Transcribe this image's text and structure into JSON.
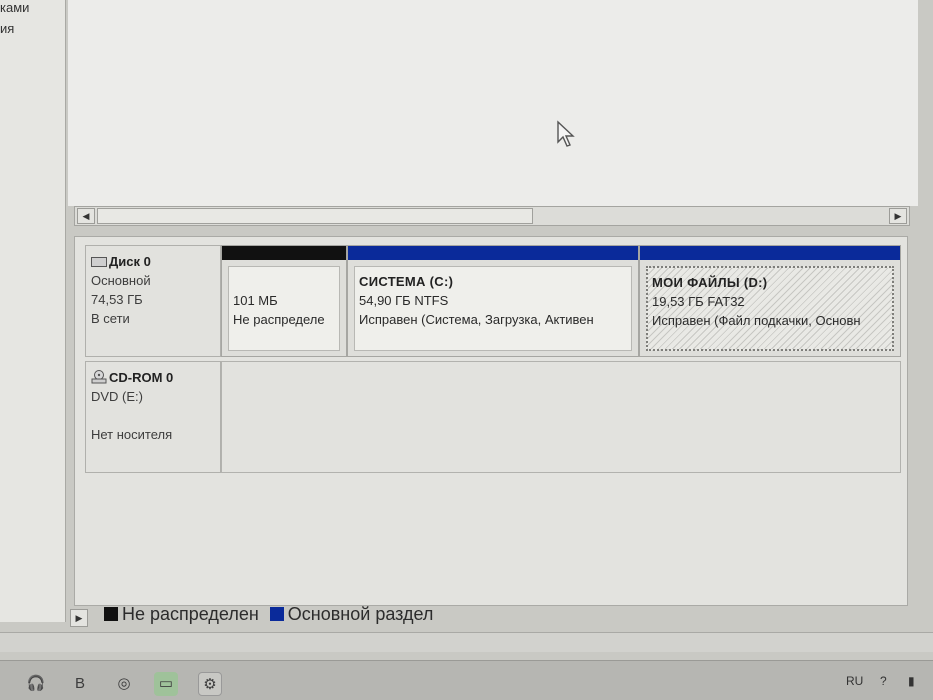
{
  "left_pane": {
    "line1": "ками",
    "line2": "ия"
  },
  "disks": [
    {
      "title": "Диск 0",
      "type": "Основной",
      "size": "74,53 ГБ",
      "status": "В сети",
      "partitions": [
        {
          "kind": "unallocated",
          "name": "",
          "size": "101 МБ",
          "status": "Не распределе",
          "bar_color": "#111111"
        },
        {
          "kind": "primary",
          "name": "СИСТЕМА  (C:)",
          "size": "54,90 ГБ NTFS",
          "status": "Исправен (Система, Загрузка, Активен",
          "bar_color": "#0a2a9a"
        },
        {
          "kind": "primary",
          "name": "МОИ ФАЙЛЫ  (D:)",
          "size": "19,53 ГБ FAT32",
          "status": "Исправен (Файл подкачки, Основн",
          "bar_color": "#0a2a9a"
        }
      ]
    }
  ],
  "cdrom": {
    "title": "CD-ROM 0",
    "type": "DVD (E:)",
    "status": "Нет носителя"
  },
  "legend": [
    {
      "label": "Не распределен",
      "color": "#111111"
    },
    {
      "label": "Основной раздел",
      "color": "#0a2a9a"
    }
  ],
  "tray": {
    "language": "RU"
  },
  "icons": {
    "scroll_left": "arrow-left-icon",
    "scroll_right": "arrow-right-icon",
    "disk": "hard-disk-icon",
    "cdrom": "cd-rom-icon",
    "cursor": "mouse-pointer-icon"
  }
}
